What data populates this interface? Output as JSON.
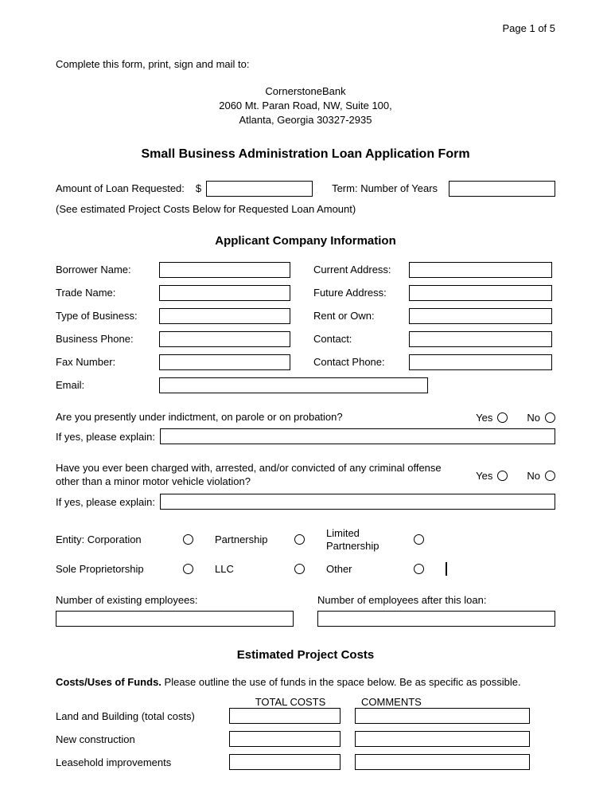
{
  "page_number": "Page 1 of 5",
  "instruction": "Complete this form, print, sign and mail to:",
  "address": {
    "line1": "CornerstoneBank",
    "line2": "2060 Mt. Paran Road, NW, Suite 100,",
    "line3": "Atlanta, Georgia 30327-2935"
  },
  "form_title": "Small Business Administration Loan Application Form",
  "loan": {
    "amount_label": "Amount of Loan Requested:",
    "currency": "$",
    "term_label": "Term: Number of Years",
    "note": "(See estimated Project Costs Below for Requested Loan Amount)"
  },
  "section_company": "Applicant Company Information",
  "fields": {
    "borrower_name": "Borrower Name:",
    "trade_name": "Trade Name:",
    "type_of_business": "Type of Business:",
    "business_phone": "Business Phone:",
    "fax_number": "Fax Number:",
    "email": "Email:",
    "current_address": "Current Address:",
    "future_address": "Future Address:",
    "rent_or_own": "Rent or Own:",
    "contact": "Contact:",
    "contact_phone": "Contact Phone:"
  },
  "q1": {
    "text": "Are you presently under indictment, on parole or on probation?",
    "yes": "Yes",
    "no": "No",
    "explain": "If yes, please explain:"
  },
  "q2": {
    "text": "Have you ever been charged with, arrested, and/or convicted of any criminal offense other than a minor motor vehicle violation?",
    "yes": "Yes",
    "no": "No",
    "explain": "If yes, please explain:"
  },
  "entity": {
    "corporation": "Entity: Corporation",
    "partnership": "Partnership",
    "limited_partnership": "Limited Partnership",
    "sole": "Sole Proprietorship",
    "llc": "LLC",
    "other": "Other"
  },
  "employees": {
    "existing": "Number of existing employees:",
    "after": "Number of employees after this loan:"
  },
  "section_costs": "Estimated Project Costs",
  "costs": {
    "intro_bold": "Costs/Uses of Funds.",
    "intro_rest": " Please outline the use of funds in the space below. Be as specific as possible.",
    "head_total": "TOTAL COSTS",
    "head_comments": "COMMENTS",
    "rows": {
      "land": "Land and Building (total costs)",
      "new_construction": "New construction",
      "leasehold": "Leasehold improvements"
    }
  }
}
